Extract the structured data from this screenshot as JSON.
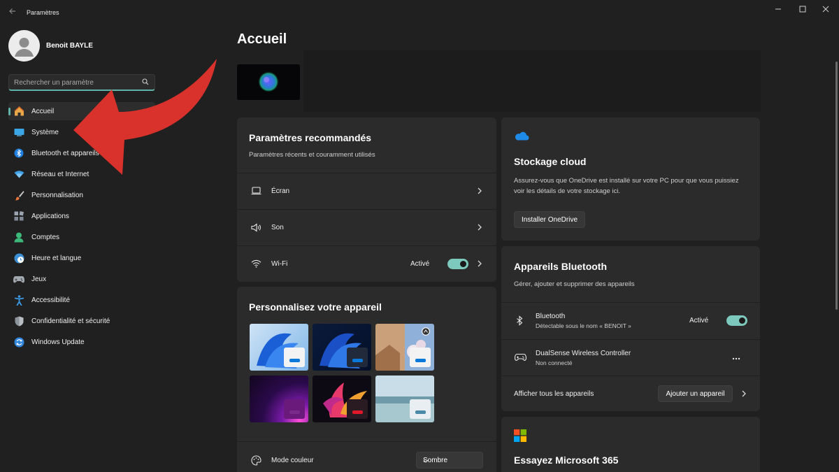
{
  "window": {
    "title": "Paramètres"
  },
  "profile": {
    "name": "Benoit BAYLE"
  },
  "search": {
    "placeholder": "Rechercher un paramètre"
  },
  "sidebar": {
    "items": [
      {
        "label": "Accueil",
        "icon": "home-icon"
      },
      {
        "label": "Système",
        "icon": "system-icon"
      },
      {
        "label": "Bluetooth et appareils",
        "icon": "bluetooth-icon"
      },
      {
        "label": "Réseau et Internet",
        "icon": "wifi-icon"
      },
      {
        "label": "Personnalisation",
        "icon": "brush-icon"
      },
      {
        "label": "Applications",
        "icon": "apps-icon"
      },
      {
        "label": "Comptes",
        "icon": "account-icon"
      },
      {
        "label": "Heure et langue",
        "icon": "clock-globe-icon"
      },
      {
        "label": "Jeux",
        "icon": "gamepad-icon"
      },
      {
        "label": "Accessibilité",
        "icon": "accessibility-icon"
      },
      {
        "label": "Confidentialité et sécurité",
        "icon": "shield-icon"
      },
      {
        "label": "Windows Update",
        "icon": "update-icon"
      }
    ]
  },
  "main": {
    "title": "Accueil",
    "recommended": {
      "title": "Paramètres recommandés",
      "subtitle": "Paramètres récents et couramment utilisés",
      "rows": [
        {
          "label": "Écran",
          "icon": "laptop-icon"
        },
        {
          "label": "Son",
          "icon": "speaker-icon"
        },
        {
          "label": "Wi-Fi",
          "icon": "wifi-icon",
          "state": "Activé",
          "toggle": true
        }
      ]
    },
    "personalize": {
      "title": "Personnalisez votre appareil",
      "color_mode_label": "Mode couleur",
      "color_mode_value": "Sombre"
    },
    "cloud": {
      "title": "Stockage cloud",
      "description": "Assurez-vous que OneDrive est installé sur votre PC pour que vous puissiez voir les détails de votre stockage ici.",
      "button": "Installer OneDrive"
    },
    "bluetooth": {
      "title": "Appareils Bluetooth",
      "subtitle": "Gérer, ajouter et supprimer des appareils",
      "bt_row": {
        "label": "Bluetooth",
        "sub": "Détectable sous le nom « BENOIT »",
        "state": "Activé"
      },
      "device": {
        "name": "DualSense Wireless Controller",
        "status": "Non connecté"
      },
      "show_all": "Afficher tous les appareils",
      "add_button": "Ajouter un appareil"
    },
    "m365": {
      "title": "Essayez Microsoft 365"
    }
  },
  "colors": {
    "accent": "#5fb3a8",
    "annotation_arrow": "#d9312b"
  }
}
